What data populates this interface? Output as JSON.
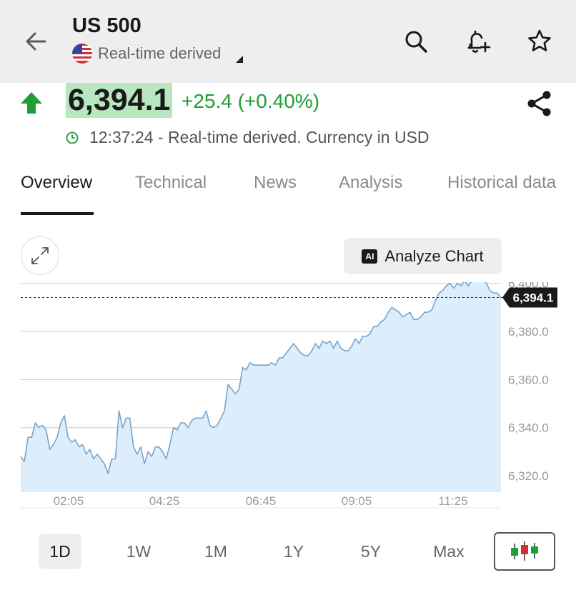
{
  "header": {
    "title": "US 500",
    "subtitle": "Real-time derived"
  },
  "quote": {
    "price": "6,394.1",
    "change": "+25.4 (+0.40%)",
    "time_line": "12:37:24 - Real-time derived. Currency in USD",
    "direction": "up"
  },
  "tabs": [
    {
      "label": "Overview",
      "active": true
    },
    {
      "label": "Technical"
    },
    {
      "label": "News"
    },
    {
      "label": "Analysis"
    },
    {
      "label": "Historical data"
    }
  ],
  "chart_toolbar": {
    "analyze_label": "Analyze Chart",
    "ai_badge": "AI"
  },
  "chart_data": {
    "type": "area",
    "x_tick_labels": [
      "02:05",
      "04:25",
      "06:45",
      "09:05",
      "11:25"
    ],
    "y_tick_labels": [
      "6,320.0",
      "6,340.0",
      "6,360.0",
      "6,380.0",
      "6,400.0"
    ],
    "ylim": [
      6313.2,
      6400.5
    ],
    "last_price_label": "6,394.1",
    "last_price": 6394.1,
    "values": [
      6328,
      6326,
      6336,
      6336,
      6342,
      6340,
      6341,
      6339,
      6331,
      6333,
      6336,
      6342,
      6345,
      6336,
      6334,
      6335,
      6332,
      6333,
      6329,
      6331,
      6327,
      6329,
      6327,
      6325,
      6321,
      6327,
      6327,
      6347,
      6340,
      6344,
      6344,
      6332,
      6329,
      6332,
      6325,
      6330,
      6328,
      6332,
      6332,
      6330,
      6327,
      6333,
      6340,
      6339,
      6342,
      6342,
      6340,
      6343,
      6344,
      6344,
      6344,
      6347,
      6341,
      6340,
      6341,
      6344,
      6347,
      6358,
      6356,
      6354,
      6356,
      6365,
      6364,
      6367,
      6366,
      6366,
      6366,
      6366,
      6366,
      6367,
      6366,
      6369,
      6369,
      6371,
      6373,
      6375,
      6373,
      6371,
      6370,
      6370,
      6372,
      6375,
      6373,
      6376,
      6375,
      6376,
      6373,
      6376,
      6373,
      6372,
      6372,
      6374,
      6377,
      6375,
      6378,
      6378,
      6379,
      6382,
      6382,
      6384,
      6385,
      6388,
      6390,
      6389,
      6388,
      6386,
      6387,
      6388,
      6385,
      6385,
      6386,
      6388,
      6388,
      6389,
      6393,
      6396,
      6397,
      6399,
      6400,
      6398,
      6400,
      6399,
      6401,
      6399,
      6401,
      6402,
      6403,
      6402,
      6400,
      6397,
      6396,
      6396,
      6394
    ],
    "grid": "horizontal",
    "colors": {
      "line": "#7aa4c8",
      "fill": "#dcedfb",
      "grid": "#cccccc",
      "text": "#9a9a9a"
    }
  },
  "ranges": [
    {
      "label": "1D",
      "active": true
    },
    {
      "label": "1W"
    },
    {
      "label": "1M"
    },
    {
      "label": "1Y"
    },
    {
      "label": "5Y"
    },
    {
      "label": "Max"
    }
  ],
  "icons": {
    "back": "arrow-left-icon",
    "search": "search-icon",
    "alert": "bell-plus-icon",
    "watchlist": "star-icon",
    "share": "share-icon",
    "expand": "expand-icon",
    "chart_type": "candlestick-icon"
  },
  "colors": {
    "up": "#1e9e35",
    "price_bg": "#b8e6bf",
    "topbar_bg": "#eeeeee"
  }
}
